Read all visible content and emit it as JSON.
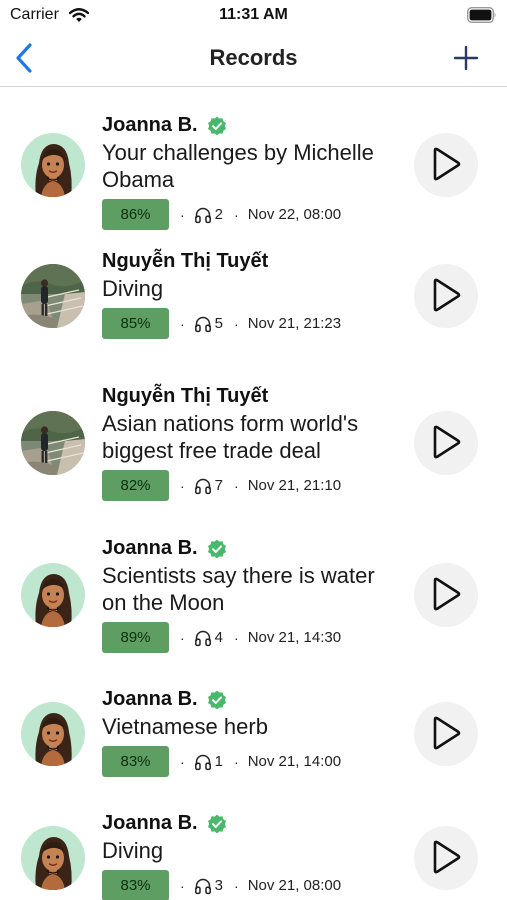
{
  "status_bar": {
    "carrier": "Carrier",
    "time": "11:31 AM"
  },
  "nav": {
    "title": "Records",
    "back_icon": "chevron-left-icon",
    "add_icon": "plus-icon"
  },
  "colors": {
    "accent": "#1f7ae0",
    "badge": "#5f9e63",
    "verified": "#48b86a",
    "play_bg": "#f1f1f2"
  },
  "records": [
    {
      "user": "Joanna B.",
      "verified": true,
      "avatar": "cartoon-woman",
      "title": "Your challenges by Michelle Obama",
      "score": "86%",
      "listens": "2",
      "date": "Nov 22, 08:00"
    },
    {
      "user": "Nguyễn Thị Tuyết",
      "verified": false,
      "avatar": "photo",
      "title": "Diving",
      "score": "85%",
      "listens": "5",
      "date": "Nov 21, 21:23"
    },
    {
      "user": "Nguyễn Thị Tuyết",
      "verified": false,
      "avatar": "photo",
      "title": "Asian nations form world's biggest free trade deal",
      "score": "82%",
      "listens": "7",
      "date": "Nov 21, 21:10"
    },
    {
      "user": "Joanna B.",
      "verified": true,
      "avatar": "cartoon-woman",
      "title": "Scientists say there is water on the Moon",
      "score": "89%",
      "listens": "4",
      "date": "Nov 21, 14:30"
    },
    {
      "user": "Joanna B.",
      "verified": true,
      "avatar": "cartoon-woman",
      "title": "Vietnamese herb",
      "score": "83%",
      "listens": "1",
      "date": "Nov 21, 14:00"
    },
    {
      "user": "Joanna B.",
      "verified": true,
      "avatar": "cartoon-woman",
      "title": "Diving",
      "score": "83%",
      "listens": "3",
      "date": "Nov 21, 08:00"
    }
  ]
}
